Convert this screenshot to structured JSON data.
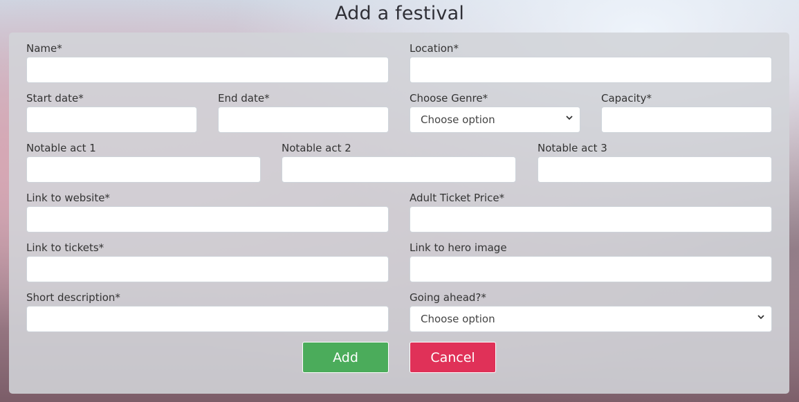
{
  "page": {
    "title": "Add a festival"
  },
  "form": {
    "name_label": "Name*",
    "location_label": "Location*",
    "start_date_label": "Start date*",
    "end_date_label": "End date*",
    "genre_label": "Choose Genre*",
    "genre_value": "Choose option",
    "capacity_label": "Capacity*",
    "act1_label": "Notable act 1",
    "act2_label": "Notable act 2",
    "act3_label": "Notable act 3",
    "website_label": "Link to website*",
    "adult_price_label": "Adult Ticket Price*",
    "tickets_label": "Link to tickets*",
    "hero_image_label": "Link to hero image",
    "description_label": "Short description*",
    "going_ahead_label": "Going ahead?*",
    "going_ahead_value": "Choose option"
  },
  "buttons": {
    "add_label": "Add",
    "cancel_label": "Cancel"
  },
  "colors": {
    "add": "#4bac5b",
    "cancel": "#e03158"
  },
  "icons": {
    "select_chevron": "chevron-down-icon"
  }
}
